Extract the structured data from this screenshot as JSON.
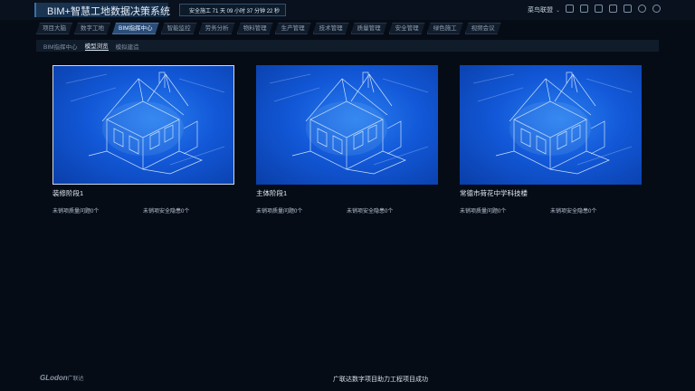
{
  "app": {
    "title": "BIM+智慧工地数据决策系统",
    "safety_text": "安全施工 71 天 09 小时 37 分钟 22 秒",
    "user": "菜鸟联盟"
  },
  "header_icons": [
    "grid-icon",
    "monitor-icon",
    "tablet-icon",
    "shield-icon",
    "bell-icon",
    "refresh-icon",
    "power-icon"
  ],
  "nav": {
    "tabs": [
      "项目大脑",
      "数字工地",
      "BIM指挥中心",
      "智能监控",
      "劳务分析",
      "物料管理",
      "生产管理",
      "技术管理",
      "质量管理",
      "安全管理",
      "绿色施工",
      "视频会议"
    ],
    "active_index": 2
  },
  "subnav": {
    "tabs": [
      "BIM指挥中心",
      "模型浏览",
      "模拟建造"
    ],
    "active_index": 1
  },
  "cards": [
    {
      "name": "装修阶段1",
      "quality": "未销项质量问题0个",
      "safety": "未销项安全隐患0个"
    },
    {
      "name": "主体阶段1",
      "quality": "未销项质量问题0个",
      "safety": "未销项安全隐患0个"
    },
    {
      "name": "常德市荷花中学科技楼",
      "quality": "未销项质量问题0个",
      "safety": "未销项安全隐患0个"
    }
  ],
  "footer": {
    "logo": "GLodon",
    "logo_cn": "广联达",
    "slogan": "广联达数字项目助力工程项目成功"
  },
  "colors": {
    "background": "#060c16",
    "active_tab": "#2a4e7a",
    "thumb_blue": "#1258d8"
  }
}
